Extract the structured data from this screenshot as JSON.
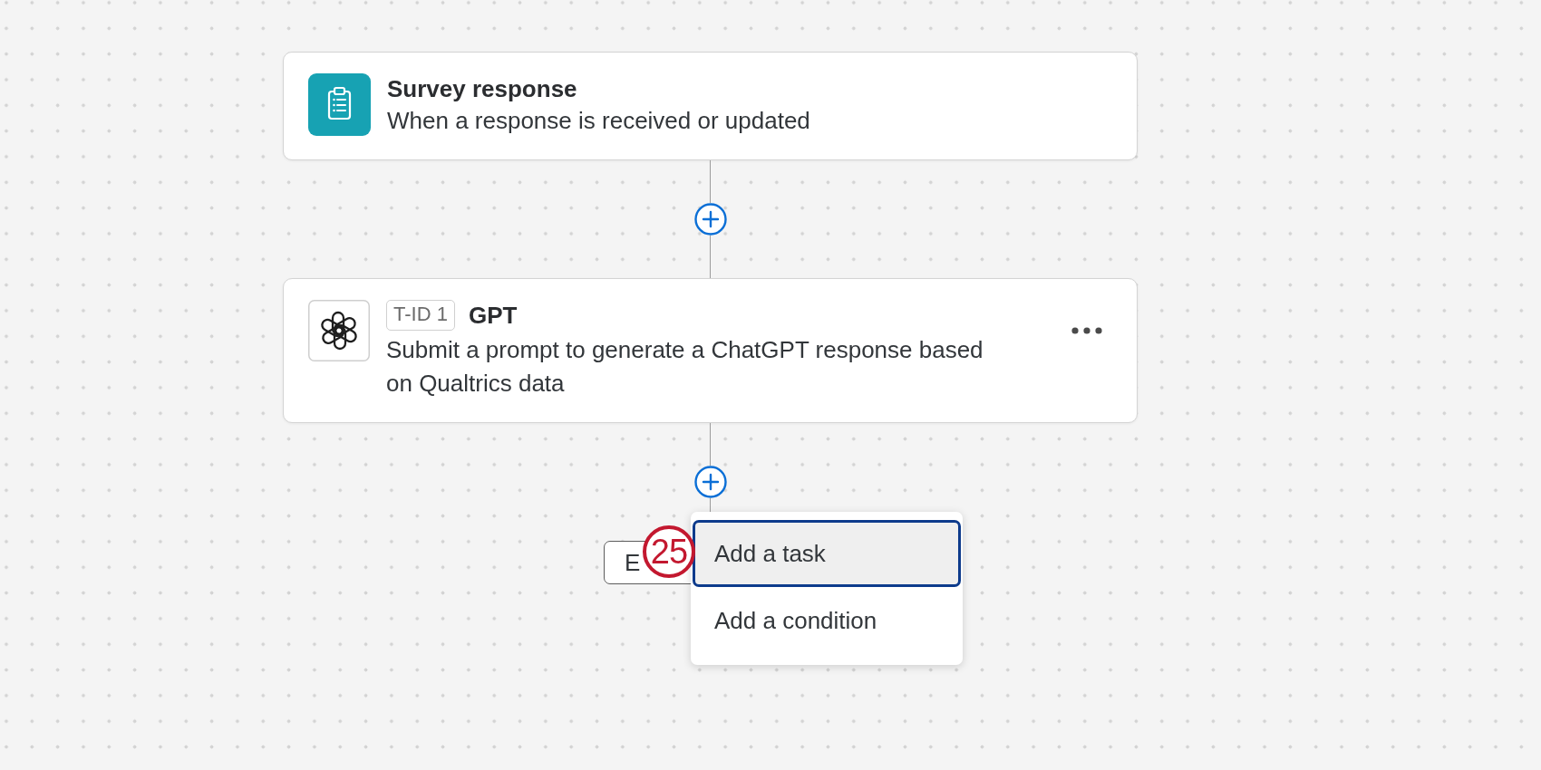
{
  "steps": [
    {
      "kind": "trigger",
      "title": "Survey response",
      "description": "When a response is received or updated"
    },
    {
      "kind": "task",
      "tag": "T-ID 1",
      "title": "GPT",
      "description": "Submit a prompt to generate a ChatGPT response based on Qualtrics data"
    }
  ],
  "end_node": {
    "label": "E"
  },
  "menu": {
    "items": [
      {
        "label": "Add a task",
        "selected": true
      },
      {
        "label": "Add a condition",
        "selected": false
      }
    ]
  },
  "step_marker": {
    "label": "25"
  }
}
